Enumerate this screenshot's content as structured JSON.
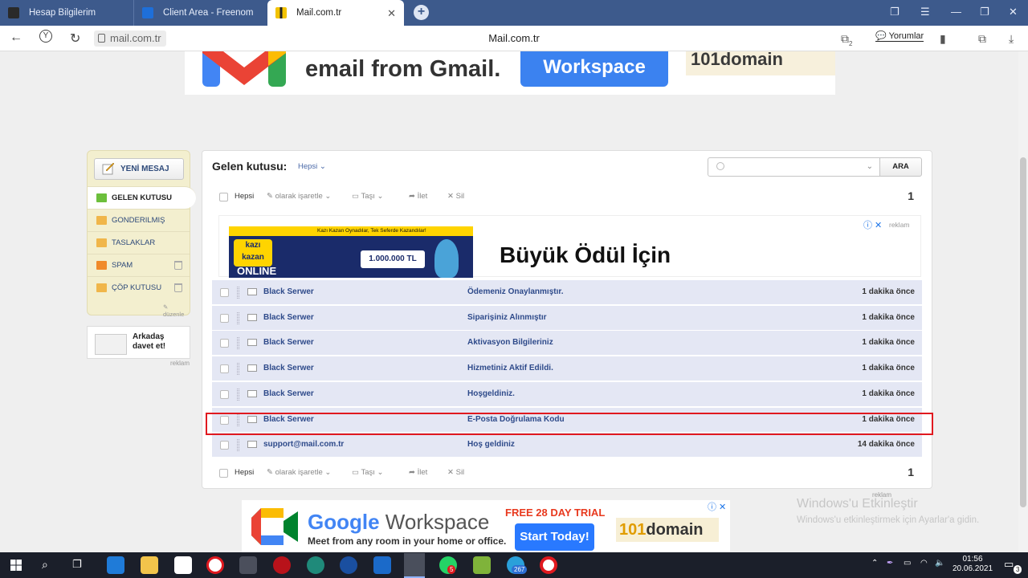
{
  "browser": {
    "tabs": [
      {
        "label": "Hesap Bilgilerim"
      },
      {
        "label": "Client Area - Freenom"
      },
      {
        "label": "Mail.com.tr"
      }
    ],
    "url": "mail.com.tr",
    "page_title": "Mail.com.tr",
    "comments_label": "Yorumlar",
    "downloads_count": "2"
  },
  "top_banner": {
    "headline": "email from Gmail.",
    "workspace_label": "Workspace",
    "domain_label": "101domain"
  },
  "sidebar": {
    "new_message_label": "YENİ MESAJ",
    "folders": [
      {
        "label": "GELEN KUTUSU"
      },
      {
        "label": "GONDERILMIŞ"
      },
      {
        "label": "TASLAKLAR"
      },
      {
        "label": "SPAM"
      },
      {
        "label": "ÇÖP KUTUSU"
      }
    ],
    "edit_label": "düzenle",
    "invite_line1": "Arkadaş",
    "invite_line2": "davet et!",
    "ad_label": "reklam"
  },
  "inbox": {
    "title": "Gelen kutusu:",
    "filter_label": "Hepsi",
    "search_button": "ARA",
    "toolbar": {
      "all": "Hepsi",
      "mark_as": "olarak işaretle",
      "move": "Taşı",
      "forward": "İlet",
      "delete": "Sil",
      "page": "1"
    },
    "ad": {
      "kazi_strip": "Kazı Kazan Oynadılar, Tek Seferde Kazandılar!",
      "kazi_logo": "kazı kazan",
      "kazi_online": "ONLINE",
      "kazi_prize": "1.000.000 TL",
      "headline": "Büyük Ödül İçin",
      "label": "reklam"
    },
    "messages": [
      {
        "from": "Black Serwer",
        "subject": "Ödemeniz Onaylanmıştır.",
        "time": "1 dakika önce"
      },
      {
        "from": "Black Serwer",
        "subject": "Siparişiniz Alınmıştır",
        "time": "1 dakika önce"
      },
      {
        "from": "Black Serwer",
        "subject": "Aktivasyon Bilgileriniz",
        "time": "1 dakika önce"
      },
      {
        "from": "Black Serwer",
        "subject": "Hizmetiniz Aktif Edildi.",
        "time": "1 dakika önce"
      },
      {
        "from": "Black Serwer",
        "subject": "Hoşgeldiniz.",
        "time": "1 dakika önce"
      },
      {
        "from": "Black Serwer",
        "subject": "E-Posta Doğrulama Kodu",
        "time": "1 dakika önce"
      },
      {
        "from": "support@mail.com.tr",
        "subject": "Hoş geldiniz",
        "time": "14 dakika önce"
      }
    ]
  },
  "bottom_banner": {
    "ad_label": "reklam",
    "title_google": "Google",
    "title_rest": " Workspace",
    "subtitle": "Meet from any room in your home or office.",
    "free_trial": "FREE 28 DAY TRIAL",
    "cta": "Start Today!",
    "domain_num": "101",
    "domain_word": "domain"
  },
  "windows_activation": {
    "title": "Windows'u Etkinleştir",
    "subtitle": "Windows'u etkinleştirmek için Ayarlar'a gidin."
  },
  "taskbar": {
    "time": "01:56",
    "date": "20.06.2021",
    "whatsapp_badge": "5",
    "telegram_badge": "267",
    "notifications": "3"
  },
  "colors": {
    "tab_strip": "#3d5a8c",
    "row_bg": "#e4e7f4",
    "link_blue": "#2e4a8a",
    "highlight_red": "#e0191f",
    "sidebar_bg": "#f3efcf"
  }
}
